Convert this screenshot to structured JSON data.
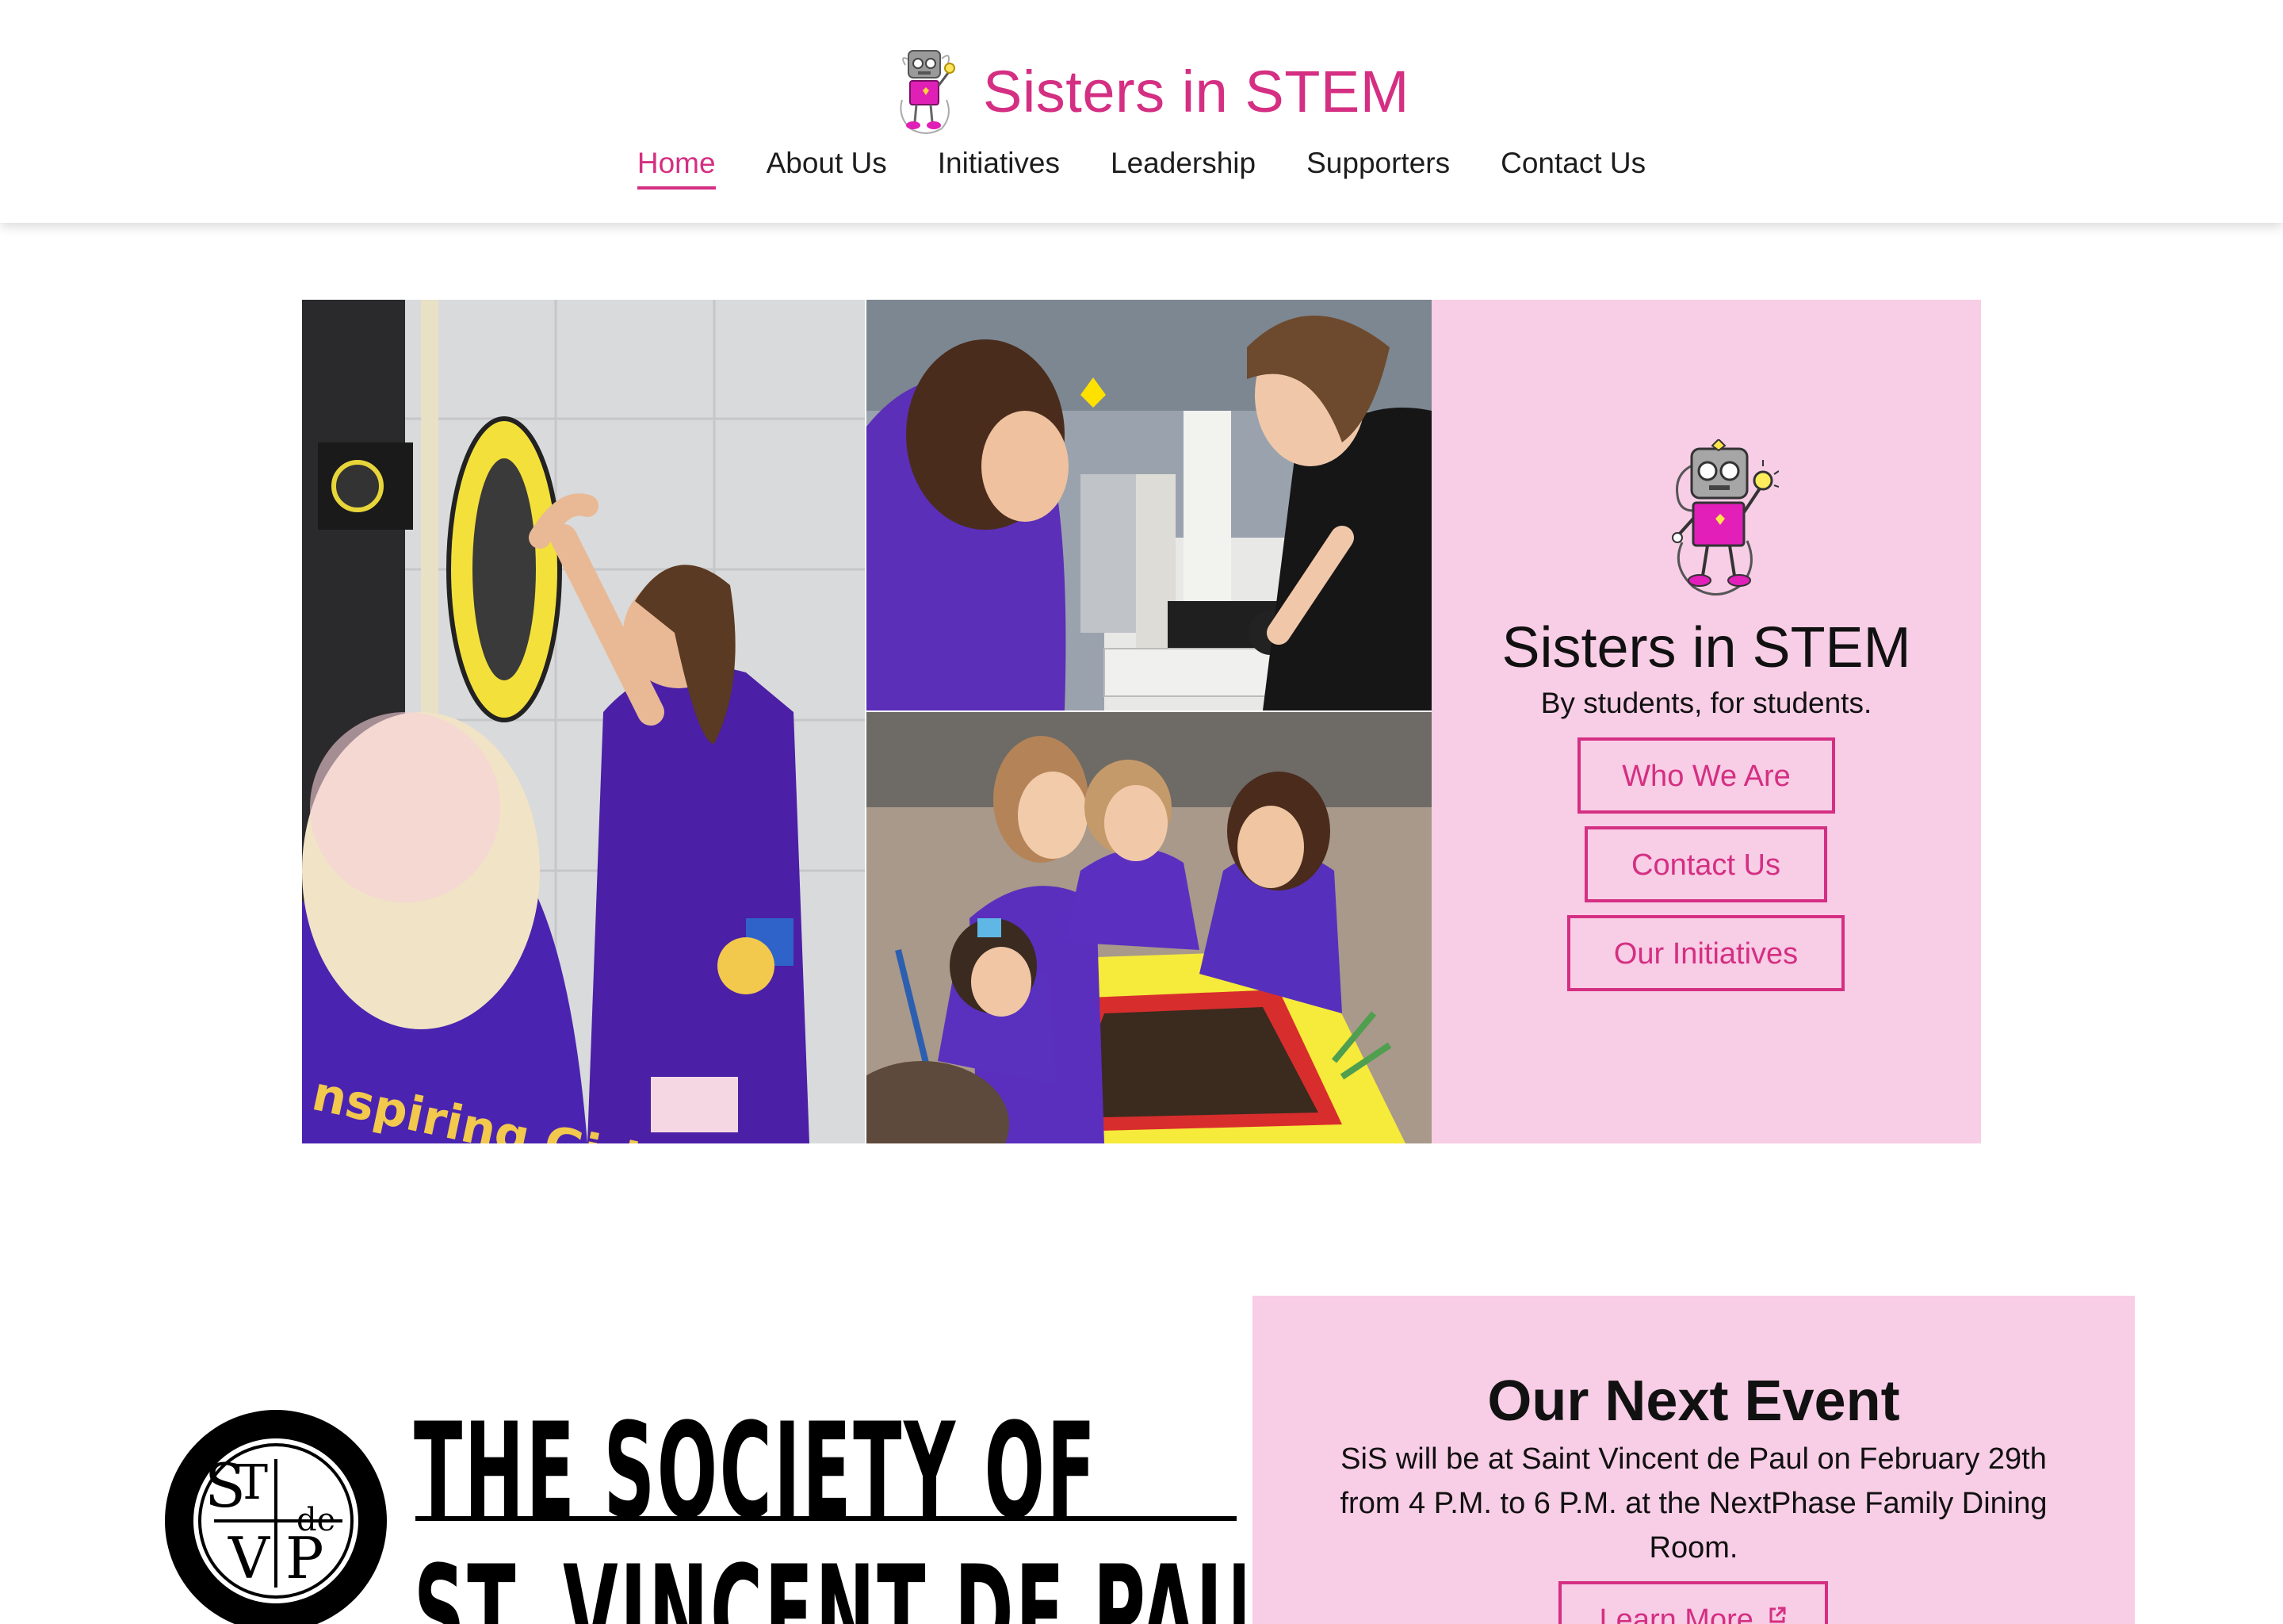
{
  "brand": {
    "name": "Sisters in STEM",
    "logo_icon": "robot-mascot-icon"
  },
  "nav": {
    "items": [
      {
        "label": "Home",
        "active": true
      },
      {
        "label": "About Us",
        "active": false
      },
      {
        "label": "Initiatives",
        "active": false
      },
      {
        "label": "Leadership",
        "active": false
      },
      {
        "label": "Supporters",
        "active": false
      },
      {
        "label": "Contact Us",
        "active": false
      }
    ]
  },
  "hero": {
    "title": "Sisters in STEM",
    "tagline": "By students, for students.",
    "buttons": {
      "who_we_are": "Who We Are",
      "contact_us": "Contact Us",
      "our_initiatives": "Our Initiatives"
    }
  },
  "sponsor_logo": {
    "line1": "THE SOCIETY OF",
    "line2": "ST. VINCENT DE PAUL",
    "emblem_letters": [
      "S",
      "T",
      "V",
      "P",
      "de"
    ]
  },
  "event": {
    "title": "Our Next Event",
    "description": "SiS will be at Saint Vincent de Paul on February 29th from 4 P.M. to 6 P.M. at the NextPhase Family Dining Room.",
    "button_label": "Learn More"
  },
  "colors": {
    "accent": "#d42f82",
    "panel": "#f8cde6",
    "text": "#111111"
  }
}
